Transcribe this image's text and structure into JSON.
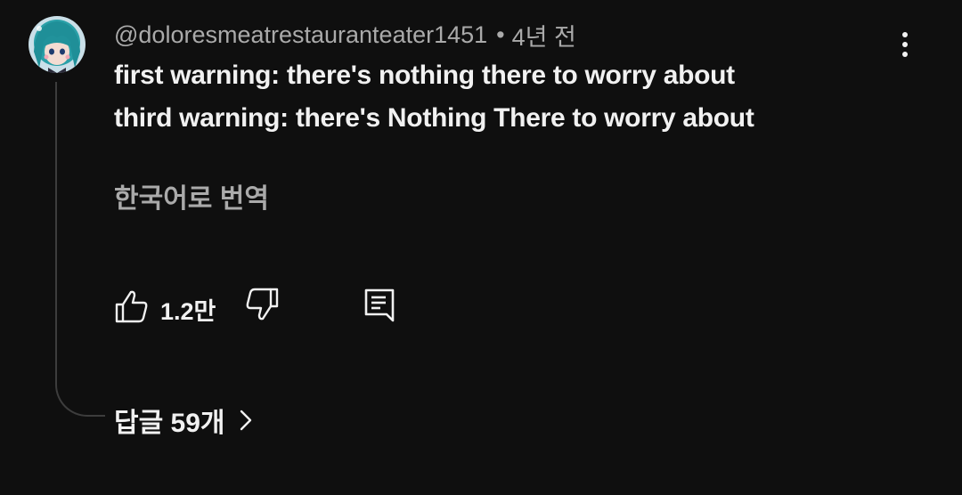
{
  "comment": {
    "author": "@doloresmeatrestauranteater1451",
    "separator": "•",
    "time": "4년 전",
    "lines": [
      "first warning: there's nothing there to worry about",
      "third warning: there's Nothing There to worry about"
    ],
    "translate_label": "한국어로 번역",
    "like_count": "1.2만",
    "replies_label": "답글 59개"
  },
  "icons": {
    "avatar": "avatar-image",
    "menu": "more-vertical-icon",
    "like": "thumbs-up-icon",
    "dislike": "thumbs-down-icon",
    "reply": "reply-comment-icon",
    "replies_chevron": "chevron-right-icon"
  },
  "colors": {
    "background": "#0f0f0f",
    "primary_text": "#f1f1f1",
    "secondary_text": "#aaaaaa",
    "thread_line": "#3d3d3d"
  }
}
